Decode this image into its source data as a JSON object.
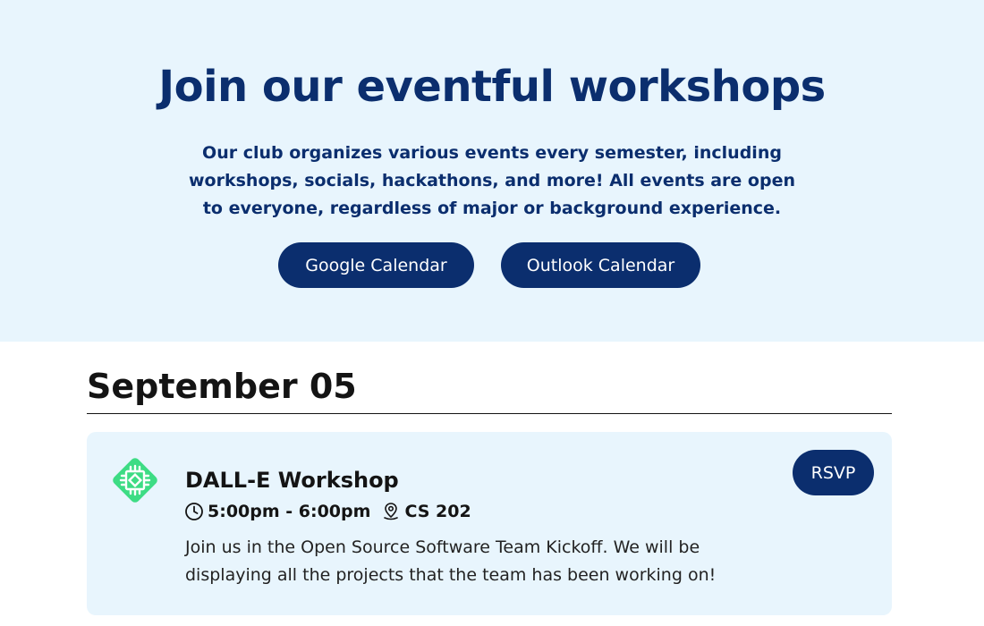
{
  "hero": {
    "title": "Join our eventful workshops",
    "description": "Our club organizes various events every semester, including workshops, socials, hackathons, and more! All events are open to everyone, regardless of major or background experience.",
    "google_calendar_label": "Google Calendar",
    "outlook_calendar_label": "Outlook Calendar"
  },
  "schedule": {
    "date_heading": "September 05",
    "events": [
      {
        "title": "DALL-E Workshop",
        "time": "5:00pm - 6:00pm",
        "location": "CS 202",
        "description": "Join us in the Open Source Software Team Kickoff. We will be displaying all the projects that the team has been working on!",
        "rsvp_label": "RSVP",
        "icon": "ai-chip-icon",
        "time_icon": "clock-icon",
        "location_icon": "map-pin-icon"
      }
    ]
  },
  "colors": {
    "hero_background": "#e8f5fd",
    "primary": "#0b2e6e",
    "card_background": "#e8f5fd",
    "icon_green": "#3ddc84",
    "text_dark": "#141414"
  }
}
